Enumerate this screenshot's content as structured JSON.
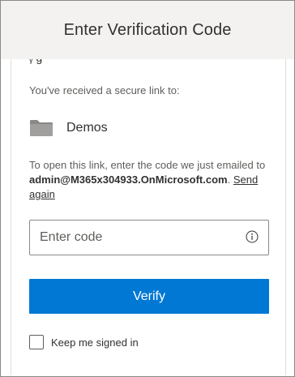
{
  "dialog": {
    "title": "Enter Verification Code"
  },
  "body": {
    "clipped_heading": "ᵧ g",
    "received_text": "You've received a secure link to:",
    "file": {
      "icon": "folder-icon",
      "name": "Demos"
    },
    "info_prefix": "To open this link, enter the code we just emailed to ",
    "email": "admin@M365x304933.OnMicrosoft.com",
    "info_separator": ". ",
    "send_again": "Send again",
    "code_input": {
      "placeholder": "Enter code",
      "value": "",
      "icon": "info-icon"
    },
    "verify_button": "Verify",
    "keep_signed_in": {
      "label": "Keep me signed in",
      "checked": false
    }
  },
  "colors": {
    "accent": "#0078d4",
    "header_bg": "#f3f2f1",
    "text_primary": "#323130",
    "text_secondary": "#605e5c",
    "border": "#8a8886"
  }
}
